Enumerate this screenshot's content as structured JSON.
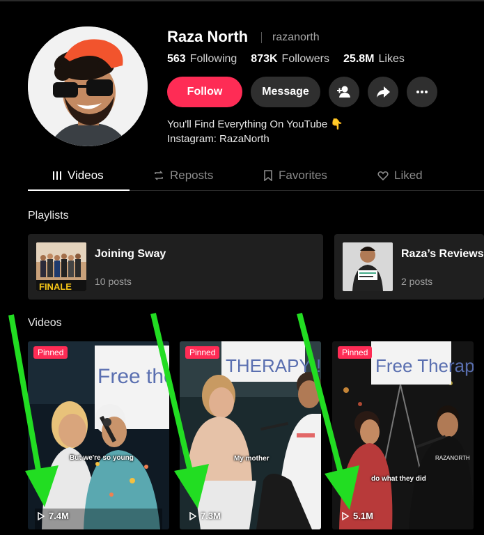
{
  "profile": {
    "name": "Raza North",
    "handle": "razanorth",
    "following_count": "563",
    "following_label": "Following",
    "followers_count": "873K",
    "followers_label": "Followers",
    "likes_count": "25.8M",
    "likes_label": "Likes",
    "follow_label": "Follow",
    "message_label": "Message",
    "bio_line1": "You'll Find Everything On YouTube 👇",
    "bio_line2": "Instagram: RazaNorth"
  },
  "tabs": [
    {
      "label": "Videos",
      "icon": "grid-icon",
      "active": true
    },
    {
      "label": "Reposts",
      "icon": "repost-icon"
    },
    {
      "label": "Favorites",
      "icon": "bookmark-icon"
    },
    {
      "label": "Liked",
      "icon": "heart-icon"
    }
  ],
  "playlists_title": "Playlists",
  "playlists": [
    {
      "title": "Joining Sway",
      "count": "10 posts",
      "thumb_text": "FINALE"
    },
    {
      "title": "Raza’s Reviews",
      "count": "2 posts"
    }
  ],
  "videos_title": "Videos",
  "videos": [
    {
      "pinned": "Pinned",
      "caption": "But we're so young",
      "views": "7.4M",
      "sign_text": "Free therapy"
    },
    {
      "pinned": "Pinned",
      "caption": "My mother",
      "views": "7.3M",
      "sign_text": "THERAPY!!"
    },
    {
      "pinned": "Pinned",
      "caption": "do what they did",
      "views": "5.1M",
      "sign_text": "Free Therapy",
      "shirt_text": "RAZANORTH"
    }
  ],
  "colors": {
    "accent": "#fe2c55",
    "arrow": "#22dd22",
    "button_bg": "#2f2f2f"
  }
}
